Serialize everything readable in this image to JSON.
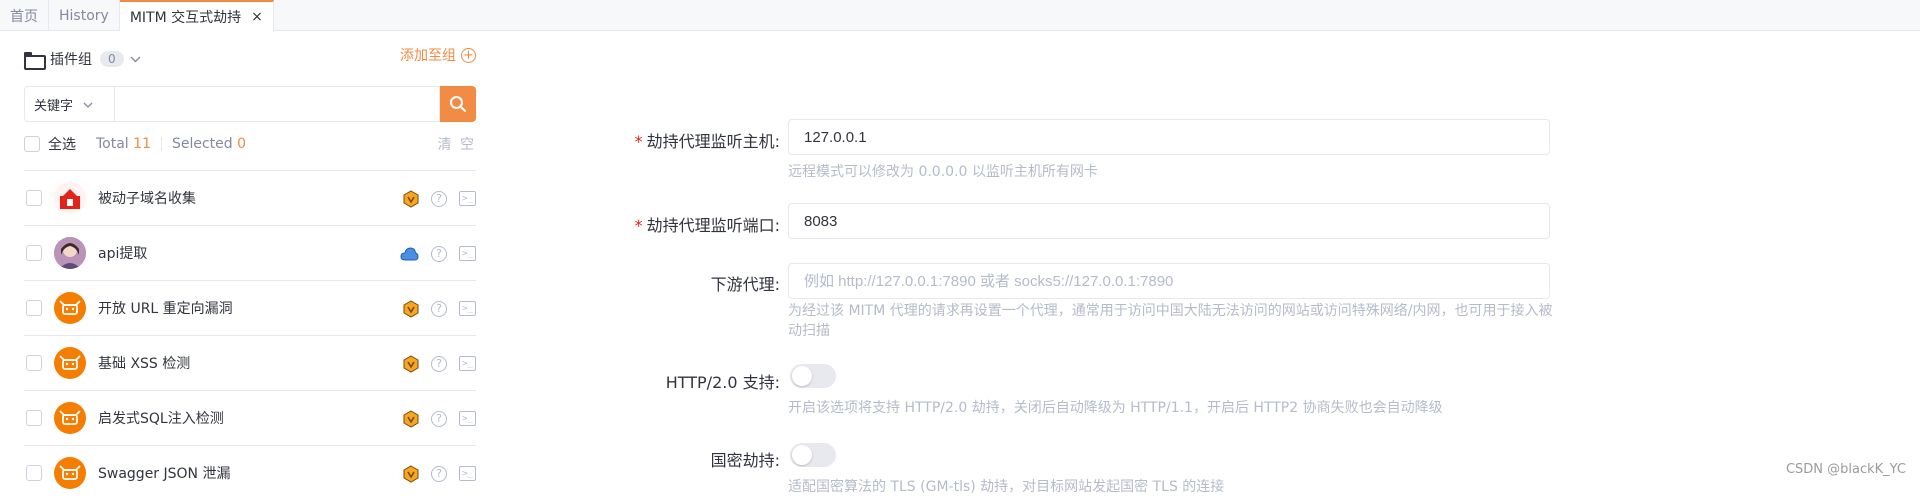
{
  "tabs": [
    {
      "label": "首页"
    },
    {
      "label": "History"
    },
    {
      "label": "MITM 交互式劫持",
      "close": "×"
    }
  ],
  "sidebar": {
    "group_label": "插件组",
    "group_count": "0",
    "add_group": "添加至组",
    "search": {
      "type": "关键字",
      "value": ""
    },
    "select_all": "全选",
    "total_label": "Total",
    "total": "11",
    "selected_label": "Selected",
    "selected": "0",
    "clear": "清 空",
    "plugins": [
      {
        "name": "被动子域名收集",
        "avatar": "red-home-icon",
        "badge": "shield-badge-icon"
      },
      {
        "name": "api提取",
        "avatar": "user-photo-avatar",
        "badge": "cloud-icon"
      },
      {
        "name": "开放 URL 重定向漏洞",
        "avatar": "yak-logo-icon",
        "badge": "shield-badge-icon"
      },
      {
        "name": "基础 XSS 检测",
        "avatar": "yak-logo-icon",
        "badge": "shield-badge-icon"
      },
      {
        "name": "启发式SQL注入检测",
        "avatar": "yak-logo-icon",
        "badge": "shield-badge-icon"
      },
      {
        "name": "Swagger JSON 泄漏",
        "avatar": "yak-logo-icon",
        "badge": "shield-badge-icon"
      }
    ]
  },
  "form": {
    "host": {
      "required": "*",
      "label": "劫持代理监听主机:",
      "value": "127.0.0.1",
      "hint": "远程模式可以修改为 0.0.0.0 以监听主机所有网卡"
    },
    "port": {
      "required": "*",
      "label": "劫持代理监听端口:",
      "value": "8083"
    },
    "downstream": {
      "label": "下游代理:",
      "placeholder": "例如 http://127.0.0.1:7890 或者 socks5://127.0.0.1:7890",
      "hint": "为经过该 MITM 代理的请求再设置一个代理，通常用于访问中国大陆无法访问的网站或访问特殊网络/内网，也可用于接入被动扫描"
    },
    "http2": {
      "label": "HTTP/2.0 支持:",
      "enabled": false,
      "hint": "开启该选项将支持 HTTP/2.0 劫持，关闭后自动降级为 HTTP/1.1，开启后 HTTP2 协商失败也会自动降级"
    },
    "gm": {
      "label": "国密劫持:",
      "enabled": false,
      "hint": "适配国密算法的 TLS (GM-tls) 劫持，对目标网站发起国密 TLS 的连接"
    }
  },
  "watermark": "CSDN @blackK_YC",
  "colors": {
    "accent": "#f28b44",
    "required": "#e2231a",
    "hint": "#b4bbca"
  }
}
